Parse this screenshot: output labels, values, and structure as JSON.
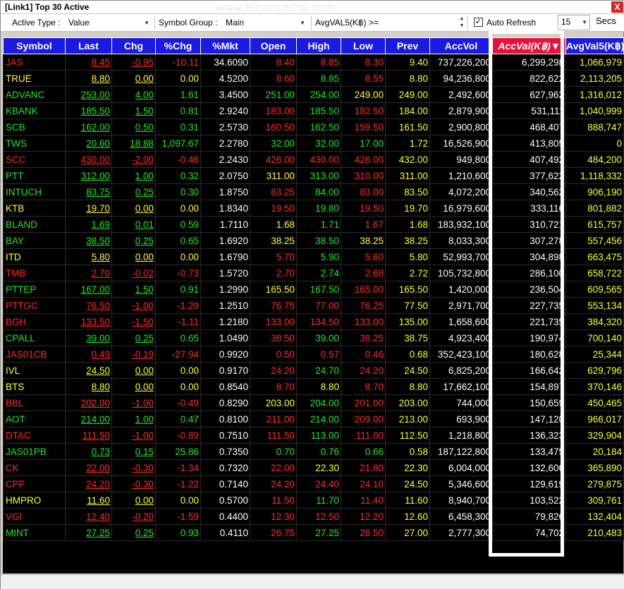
{
  "window": {
    "title": "[Link1] Top 30 Active",
    "watermark": "www.efinancethai.com",
    "close_label": "X"
  },
  "toolbar": {
    "active_type_label": "Active Type :",
    "active_type_value": "Value",
    "symbol_group_label": "Symbol Group :",
    "symbol_group_value": "Main",
    "avgval_label": "AvgVAL5(K฿) >=",
    "auto_refresh_checked": "✓",
    "auto_refresh_label": "Auto Refresh",
    "refresh_interval": "15",
    "secs_label": "Secs"
  },
  "colors": {
    "up": "#22e822",
    "down": "#ff2a2a",
    "flat": "#ffff33",
    "header_bg": "#1a1ae0",
    "sorted_header_bg": "#e8103c"
  },
  "table": {
    "headers": [
      "Symbol",
      "Last",
      "Chg",
      "%Chg",
      "%Mkt",
      "Open",
      "High",
      "Low",
      "Prev",
      "AccVol",
      "AccVal(K฿)",
      "AvgVal5(K฿)"
    ],
    "sorted_indicator": "▼",
    "rows": [
      {
        "symbol": "JAS",
        "last": "8.45",
        "chg": "-0.95",
        "pchg": "-10.11",
        "pmkt": "34.6090",
        "open": "8.40",
        "high": "8.85",
        "low": "8.30",
        "prev": "9.40",
        "accvol": "737,226,200",
        "accval": "6,299,298",
        "avgval5": "1,066,979",
        "dir": "down",
        "open_dir": "down",
        "high_dir": "down",
        "low_dir": "down"
      },
      {
        "symbol": "TRUE",
        "last": "8.80",
        "chg": "0.00",
        "pchg": "0.00",
        "pmkt": "4.5200",
        "open": "8.60",
        "high": "8.85",
        "low": "8.55",
        "prev": "8.80",
        "accvol": "94,236,800",
        "accval": "822,622",
        "avgval5": "2,113,205",
        "dir": "flat",
        "open_dir": "down",
        "high_dir": "up",
        "low_dir": "down"
      },
      {
        "symbol": "ADVANC",
        "last": "253.00",
        "chg": "4.00",
        "pchg": "1.61",
        "pmkt": "3.4500",
        "open": "251.00",
        "high": "254.00",
        "low": "249.00",
        "prev": "249.00",
        "accvol": "2,492,600",
        "accval": "627,962",
        "avgval5": "1,316,012",
        "dir": "up",
        "open_dir": "up",
        "high_dir": "up",
        "low_dir": "flat"
      },
      {
        "symbol": "KBANK",
        "last": "185.50",
        "chg": "1.50",
        "pchg": "0.81",
        "pmkt": "2.9240",
        "open": "183.00",
        "high": "185.50",
        "low": "182.50",
        "prev": "184.00",
        "accvol": "2,879,900",
        "accval": "531,111",
        "avgval5": "1,040,999",
        "dir": "up",
        "open_dir": "down",
        "high_dir": "up",
        "low_dir": "down"
      },
      {
        "symbol": "SCB",
        "last": "162.00",
        "chg": "0.50",
        "pchg": "0.31",
        "pmkt": "2.5730",
        "open": "160.50",
        "high": "162.50",
        "low": "159.50",
        "prev": "161.50",
        "accvol": "2,900,800",
        "accval": "468,407",
        "avgval5": "888,747",
        "dir": "up",
        "open_dir": "down",
        "high_dir": "up",
        "low_dir": "down"
      },
      {
        "symbol": "TWS",
        "last": "20.60",
        "chg": "18.88",
        "pchg": "1,097.67",
        "pmkt": "2.2780",
        "open": "32.00",
        "high": "32.00",
        "low": "17.00",
        "prev": "1.72",
        "accvol": "16,526,900",
        "accval": "413,805",
        "avgval5": "0",
        "dir": "up",
        "open_dir": "up",
        "high_dir": "up",
        "low_dir": "up"
      },
      {
        "symbol": "SCC",
        "last": "430.00",
        "chg": "-2.00",
        "pchg": "-0.46",
        "pmkt": "2.2430",
        "open": "426.00",
        "high": "430.00",
        "low": "426.00",
        "prev": "432.00",
        "accvol": "949,800",
        "accval": "407,492",
        "avgval5": "484,200",
        "dir": "down",
        "open_dir": "down",
        "high_dir": "down",
        "low_dir": "down"
      },
      {
        "symbol": "PTT",
        "last": "312.00",
        "chg": "1.00",
        "pchg": "0.32",
        "pmkt": "2.0750",
        "open": "311.00",
        "high": "313.00",
        "low": "310.00",
        "prev": "311.00",
        "accvol": "1,210,600",
        "accval": "377,622",
        "avgval5": "1,118,332",
        "dir": "up",
        "open_dir": "flat",
        "high_dir": "up",
        "low_dir": "down"
      },
      {
        "symbol": "INTUCH",
        "last": "83.75",
        "chg": "0.25",
        "pchg": "0.30",
        "pmkt": "1.8750",
        "open": "83.25",
        "high": "84.00",
        "low": "83.00",
        "prev": "83.50",
        "accvol": "4,072,200",
        "accval": "340,562",
        "avgval5": "906,190",
        "dir": "up",
        "open_dir": "down",
        "high_dir": "up",
        "low_dir": "down"
      },
      {
        "symbol": "KTB",
        "last": "19.70",
        "chg": "0.00",
        "pchg": "0.00",
        "pmkt": "1.8340",
        "open": "19.50",
        "high": "19.80",
        "low": "19.50",
        "prev": "19.70",
        "accvol": "16,979,600",
        "accval": "333,116",
        "avgval5": "801,882",
        "dir": "flat",
        "open_dir": "down",
        "high_dir": "up",
        "low_dir": "down"
      },
      {
        "symbol": "BLAND",
        "last": "1.69",
        "chg": "0.01",
        "pchg": "0.59",
        "pmkt": "1.7110",
        "open": "1.68",
        "high": "1.71",
        "low": "1.67",
        "prev": "1.68",
        "accvol": "183,932,100",
        "accval": "310,721",
        "avgval5": "615,757",
        "dir": "up",
        "open_dir": "flat",
        "high_dir": "up",
        "low_dir": "down"
      },
      {
        "symbol": "BAY",
        "last": "38.50",
        "chg": "0.25",
        "pchg": "0.65",
        "pmkt": "1.6920",
        "open": "38.25",
        "high": "38.50",
        "low": "38.25",
        "prev": "38.25",
        "accvol": "8,033,300",
        "accval": "307,278",
        "avgval5": "557,456",
        "dir": "up",
        "open_dir": "flat",
        "high_dir": "up",
        "low_dir": "flat"
      },
      {
        "symbol": "ITD",
        "last": "5.80",
        "chg": "0.00",
        "pchg": "0.00",
        "pmkt": "1.6790",
        "open": "5.70",
        "high": "5.90",
        "low": "5.60",
        "prev": "5.80",
        "accvol": "52,993,700",
        "accval": "304,898",
        "avgval5": "663,475",
        "dir": "flat",
        "open_dir": "down",
        "high_dir": "up",
        "low_dir": "down"
      },
      {
        "symbol": "TMB",
        "last": "2.70",
        "chg": "-0.02",
        "pchg": "-0.73",
        "pmkt": "1.5720",
        "open": "2.70",
        "high": "2.74",
        "low": "2.68",
        "prev": "2.72",
        "accvol": "105,732,800",
        "accval": "286,100",
        "avgval5": "658,722",
        "dir": "down",
        "open_dir": "down",
        "high_dir": "up",
        "low_dir": "down"
      },
      {
        "symbol": "PTTEP",
        "last": "167.00",
        "chg": "1.50",
        "pchg": "0.91",
        "pmkt": "1.2990",
        "open": "165.50",
        "high": "167.50",
        "low": "165.00",
        "prev": "165.50",
        "accvol": "1,420,000",
        "accval": "236,504",
        "avgval5": "609,565",
        "dir": "up",
        "open_dir": "flat",
        "high_dir": "up",
        "low_dir": "down"
      },
      {
        "symbol": "PTTGC",
        "last": "76.50",
        "chg": "-1.00",
        "pchg": "-1.29",
        "pmkt": "1.2510",
        "open": "76.75",
        "high": "77.00",
        "low": "76.25",
        "prev": "77.50",
        "accvol": "2,971,700",
        "accval": "227,735",
        "avgval5": "553,134",
        "dir": "down",
        "open_dir": "down",
        "high_dir": "down",
        "low_dir": "down"
      },
      {
        "symbol": "BGH",
        "last": "133.50",
        "chg": "-1.50",
        "pchg": "-1.11",
        "pmkt": "1.2180",
        "open": "133.00",
        "high": "134.50",
        "low": "133.00",
        "prev": "135.00",
        "accvol": "1,658,600",
        "accval": "221,735",
        "avgval5": "384,320",
        "dir": "down",
        "open_dir": "down",
        "high_dir": "down",
        "low_dir": "down"
      },
      {
        "symbol": "CPALL",
        "last": "39.00",
        "chg": "0.25",
        "pchg": "0.65",
        "pmkt": "1.0490",
        "open": "38.50",
        "high": "39.00",
        "low": "38.25",
        "prev": "38.75",
        "accvol": "4,923,400",
        "accval": "190,974",
        "avgval5": "700,140",
        "dir": "up",
        "open_dir": "down",
        "high_dir": "up",
        "low_dir": "down"
      },
      {
        "symbol": "JAS01CB",
        "last": "0.49",
        "chg": "-0.19",
        "pchg": "-27.94",
        "pmkt": "0.9920",
        "open": "0.50",
        "high": "0.57",
        "low": "0.46",
        "prev": "0.68",
        "accvol": "352,423,100",
        "accval": "180,628",
        "avgval5": "25,344",
        "dir": "down",
        "open_dir": "down",
        "high_dir": "down",
        "low_dir": "down"
      },
      {
        "symbol": "IVL",
        "last": "24.50",
        "chg": "0.00",
        "pchg": "0.00",
        "pmkt": "0.9170",
        "open": "24.20",
        "high": "24.70",
        "low": "24.20",
        "prev": "24.50",
        "accvol": "6,825,200",
        "accval": "166,642",
        "avgval5": "629,796",
        "dir": "flat",
        "open_dir": "down",
        "high_dir": "up",
        "low_dir": "down"
      },
      {
        "symbol": "BTS",
        "last": "8.80",
        "chg": "0.00",
        "pchg": "0.00",
        "pmkt": "0.8540",
        "open": "8.70",
        "high": "8.80",
        "low": "8.70",
        "prev": "8.80",
        "accvol": "17,662,100",
        "accval": "154,897",
        "avgval5": "370,146",
        "dir": "flat",
        "open_dir": "down",
        "high_dir": "flat",
        "low_dir": "down"
      },
      {
        "symbol": "BBL",
        "last": "202.00",
        "chg": "-1.00",
        "pchg": "-0.49",
        "pmkt": "0.8290",
        "open": "203.00",
        "high": "204.00",
        "low": "201.00",
        "prev": "203.00",
        "accvol": "744,000",
        "accval": "150,659",
        "avgval5": "450,465",
        "dir": "down",
        "open_dir": "flat",
        "high_dir": "up",
        "low_dir": "down"
      },
      {
        "symbol": "AOT",
        "last": "214.00",
        "chg": "1.00",
        "pchg": "0.47",
        "pmkt": "0.8100",
        "open": "211.00",
        "high": "214.00",
        "low": "209.00",
        "prev": "213.00",
        "accvol": "693,900",
        "accval": "147,120",
        "avgval5": "966,017",
        "dir": "up",
        "open_dir": "down",
        "high_dir": "up",
        "low_dir": "down"
      },
      {
        "symbol": "DTAC",
        "last": "111.50",
        "chg": "-1.00",
        "pchg": "-0.89",
        "pmkt": "0.7510",
        "open": "111.50",
        "high": "113.00",
        "low": "111.00",
        "prev": "112.50",
        "accvol": "1,218,800",
        "accval": "136,323",
        "avgval5": "329,904",
        "dir": "down",
        "open_dir": "down",
        "high_dir": "up",
        "low_dir": "down"
      },
      {
        "symbol": "JAS01PB",
        "last": "0.73",
        "chg": "0.15",
        "pchg": "25.86",
        "pmkt": "0.7350",
        "open": "0.70",
        "high": "0.76",
        "low": "0.66",
        "prev": "0.58",
        "accvol": "187,122,800",
        "accval": "133,475",
        "avgval5": "20,184",
        "dir": "up",
        "open_dir": "up",
        "high_dir": "up",
        "low_dir": "up"
      },
      {
        "symbol": "CK",
        "last": "22.00",
        "chg": "-0.30",
        "pchg": "-1.34",
        "pmkt": "0.7320",
        "open": "22.00",
        "high": "22.30",
        "low": "21.80",
        "prev": "22.30",
        "accvol": "6,004,000",
        "accval": "132,606",
        "avgval5": "365,890",
        "dir": "down",
        "open_dir": "down",
        "high_dir": "flat",
        "low_dir": "down"
      },
      {
        "symbol": "CPF",
        "last": "24.20",
        "chg": "-0.30",
        "pchg": "-1.22",
        "pmkt": "0.7140",
        "open": "24.20",
        "high": "24.40",
        "low": "24.10",
        "prev": "24.50",
        "accvol": "5,346,600",
        "accval": "129,619",
        "avgval5": "279,875",
        "dir": "down",
        "open_dir": "down",
        "high_dir": "down",
        "low_dir": "down"
      },
      {
        "symbol": "HMPRO",
        "last": "11.60",
        "chg": "0.00",
        "pchg": "0.00",
        "pmkt": "0.5700",
        "open": "11.50",
        "high": "11.70",
        "low": "11.40",
        "prev": "11.60",
        "accvol": "8,940,700",
        "accval": "103,522",
        "avgval5": "309,761",
        "dir": "flat",
        "open_dir": "down",
        "high_dir": "up",
        "low_dir": "down"
      },
      {
        "symbol": "VGI",
        "last": "12.40",
        "chg": "-0.20",
        "pchg": "-1.59",
        "pmkt": "0.4400",
        "open": "12.30",
        "high": "12.50",
        "low": "12.20",
        "prev": "12.60",
        "accvol": "6,458,300",
        "accval": "79,826",
        "avgval5": "132,404",
        "dir": "down",
        "open_dir": "down",
        "high_dir": "down",
        "low_dir": "down"
      },
      {
        "symbol": "MINT",
        "last": "27.25",
        "chg": "0.25",
        "pchg": "0.93",
        "pmkt": "0.4110",
        "open": "26.75",
        "high": "27.25",
        "low": "26.50",
        "prev": "27.00",
        "accvol": "2,777,300",
        "accval": "74,702",
        "avgval5": "210,483",
        "dir": "up",
        "open_dir": "down",
        "high_dir": "up",
        "low_dir": "down"
      }
    ]
  }
}
